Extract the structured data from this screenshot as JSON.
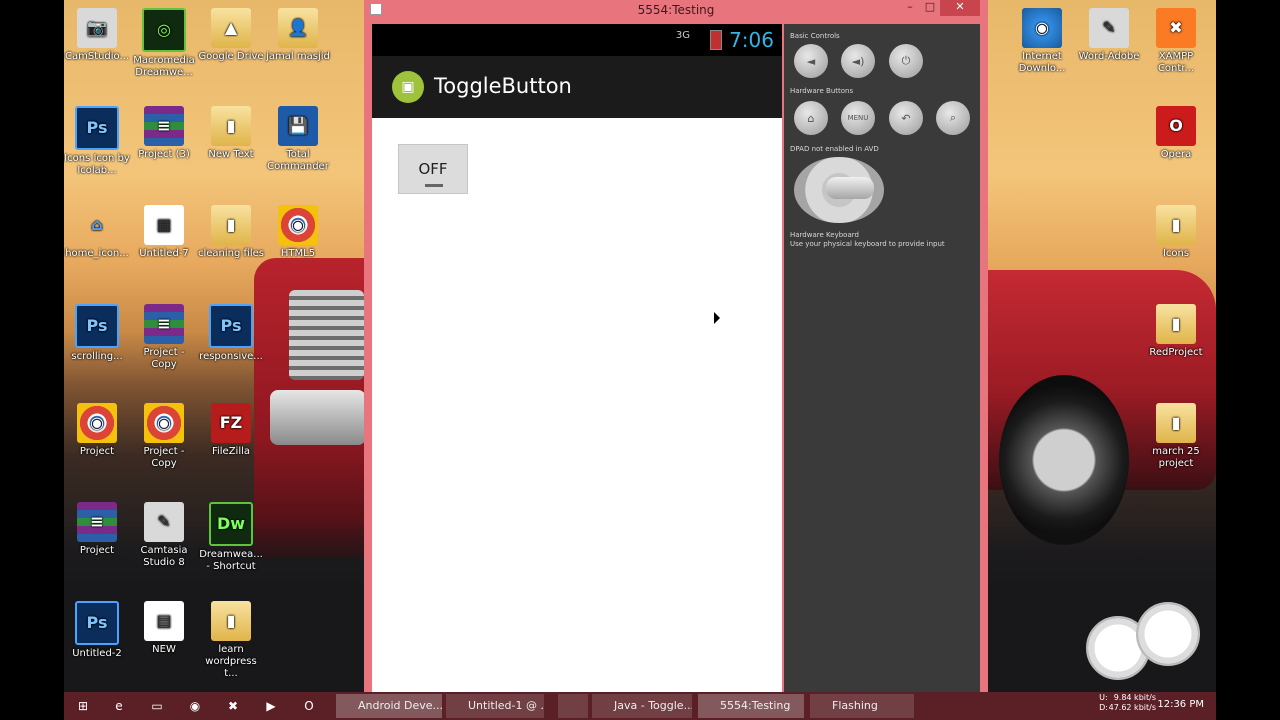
{
  "desktop": {
    "icons": [
      {
        "label": "CamStudio...",
        "glyph": "📷"
      },
      {
        "label": "Macromedia Dreamwe...",
        "glyph": "◎"
      },
      {
        "label": "Google Drive",
        "glyph": "▲"
      },
      {
        "label": "jamal masjid",
        "glyph": "👤"
      },
      {
        "label": "Icons Icon by Icolab...",
        "glyph": "Ps"
      },
      {
        "label": "Project (3)",
        "glyph": "≡"
      },
      {
        "label": "New Text",
        "glyph": "▮"
      },
      {
        "label": "Total Commander",
        "glyph": "💾"
      },
      {
        "label": "home_icon...",
        "glyph": "⌂"
      },
      {
        "label": "Untitled-7",
        "glyph": "▦"
      },
      {
        "label": "cleaning files",
        "glyph": "▮"
      },
      {
        "label": "HTML5",
        "glyph": "◉"
      },
      {
        "label": "scrolling...",
        "glyph": "Ps"
      },
      {
        "label": "Project - Copy",
        "glyph": "≡"
      },
      {
        "label": "responsive...",
        "glyph": "Ps"
      },
      {
        "label": "Project",
        "glyph": "◉"
      },
      {
        "label": "Project - Copy",
        "glyph": "◉"
      },
      {
        "label": "FileZilla",
        "glyph": "FZ"
      },
      {
        "label": "Project",
        "glyph": "≡"
      },
      {
        "label": "Camtasia Studio 8",
        "glyph": "✎"
      },
      {
        "label": "Dreamwea... - Shortcut",
        "glyph": "Dw"
      },
      {
        "label": "Untitled-2",
        "glyph": "Ps"
      },
      {
        "label": "NEW",
        "glyph": "▤"
      },
      {
        "label": "learn wordpress t...",
        "glyph": "▮"
      },
      {
        "label": "Internet Downlo...",
        "glyph": "◉"
      },
      {
        "label": "Word-Adobe",
        "glyph": "✎"
      },
      {
        "label": "XAMPP Contr...",
        "glyph": "✖"
      },
      {
        "label": "Opera",
        "glyph": "O"
      },
      {
        "label": "Icons",
        "glyph": "▮"
      },
      {
        "label": "RedProject",
        "glyph": "▮"
      },
      {
        "label": "march 25 project",
        "glyph": "▮"
      }
    ]
  },
  "window": {
    "title": "5554:Testing",
    "minimize": "–",
    "maximize": "□",
    "close": "✕"
  },
  "device": {
    "status": {
      "clock": "7:06",
      "signal": "3G"
    },
    "app_title": "ToggleButton",
    "toggle_label": "OFF"
  },
  "controls": {
    "basic_label": "Basic Controls",
    "hardware_label": "Hardware Buttons",
    "dpad_label": "DPAD not enabled in AVD",
    "keyboard_label": "Hardware Keyboard",
    "keyboard_sub": "Use your physical keyboard to provide input",
    "volume_down": "◄",
    "volume_up": "◄)",
    "power": "⏻",
    "home": "⌂",
    "menu": "MENU",
    "back": "↶",
    "search": "⌕"
  },
  "taskbar": {
    "items": [
      {
        "label": "Android Deve..."
      },
      {
        "label": "Untitled-1 @ ..."
      },
      {
        "label": ""
      },
      {
        "label": "Java - Toggle..."
      },
      {
        "label": "5554:Testing"
      },
      {
        "label": "Flashing"
      }
    ],
    "ud": "U:\nD:",
    "net_up": "9.84 kbit/s",
    "net_down": "47.62 kbit/s",
    "clock": "12:36 PM"
  }
}
